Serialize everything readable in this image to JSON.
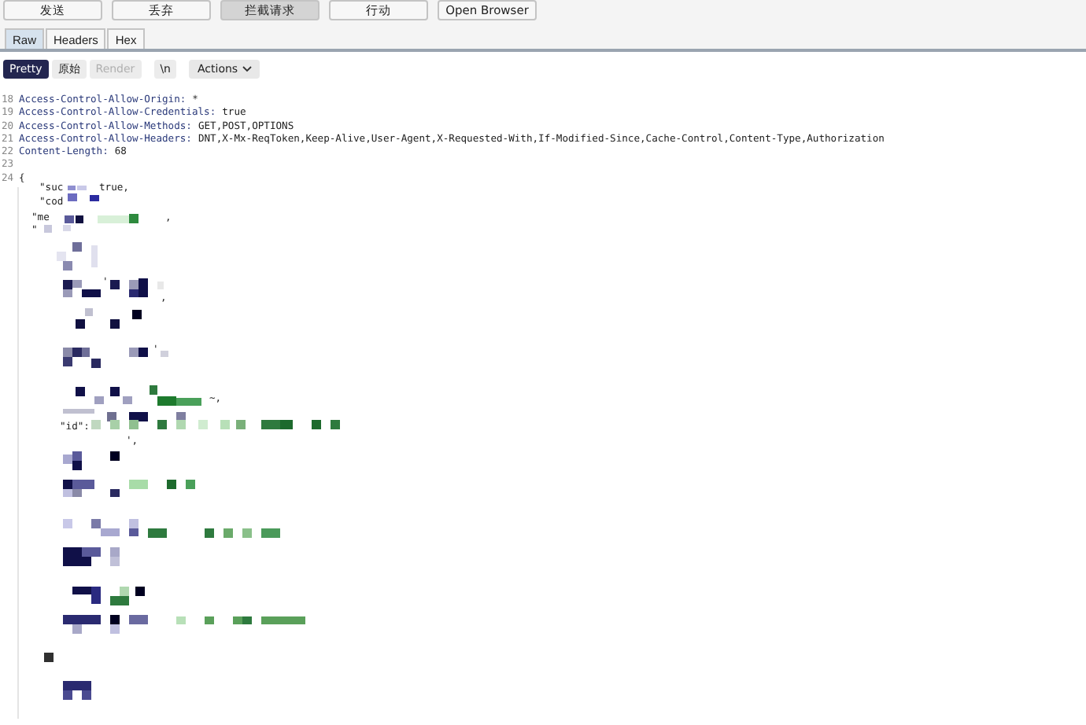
{
  "toolbar": {
    "buttons": [
      {
        "label": "发送",
        "selected": false
      },
      {
        "label": "丢弃",
        "selected": false
      },
      {
        "label": "拦截请求",
        "selected": true
      },
      {
        "label": "行动",
        "selected": false
      },
      {
        "label": "Open Browser",
        "selected": false
      }
    ]
  },
  "tabs": [
    {
      "label": "Raw",
      "selected": true
    },
    {
      "label": "Headers",
      "selected": false
    },
    {
      "label": "Hex",
      "selected": false
    }
  ],
  "view_bar": {
    "buttons": [
      {
        "label": "Pretty",
        "selected": true,
        "disabled": false
      },
      {
        "label": "原始",
        "selected": false,
        "disabled": false
      },
      {
        "label": "Render",
        "selected": false,
        "disabled": true
      },
      {
        "label": "\\n",
        "selected": false,
        "disabled": false
      }
    ],
    "actions": {
      "label": "Actions"
    }
  },
  "editor": {
    "lines": [
      {
        "number": "18",
        "key": "Access-Control-Allow-Origin:",
        "value": "*"
      },
      {
        "number": "19",
        "key": "Access-Control-Allow-Credentials:",
        "value": "true"
      },
      {
        "number": "20",
        "key": "Access-Control-Allow-Methods:",
        "value": "GET,POST,OPTIONS"
      },
      {
        "number": "21",
        "key": "Access-Control-Allow-Headers:",
        "value": "DNT,X-Mx-ReqToken,Keep-Alive,User-Agent,X-Requested-With,If-Modified-Since,Cache-Control,Content-Type,Authorization"
      },
      {
        "number": "22",
        "key": "Content-Length:",
        "value": "68"
      },
      {
        "number": "23"
      },
      {
        "number": "24",
        "text": "{"
      }
    ],
    "body_fragments": [
      "\"suc",
      "true,",
      "\"cod",
      "\"me",
      ",",
      "\"",
      "'",
      ",",
      "'",
      "~,",
      "\"id\":",
      "',"
    ]
  }
}
